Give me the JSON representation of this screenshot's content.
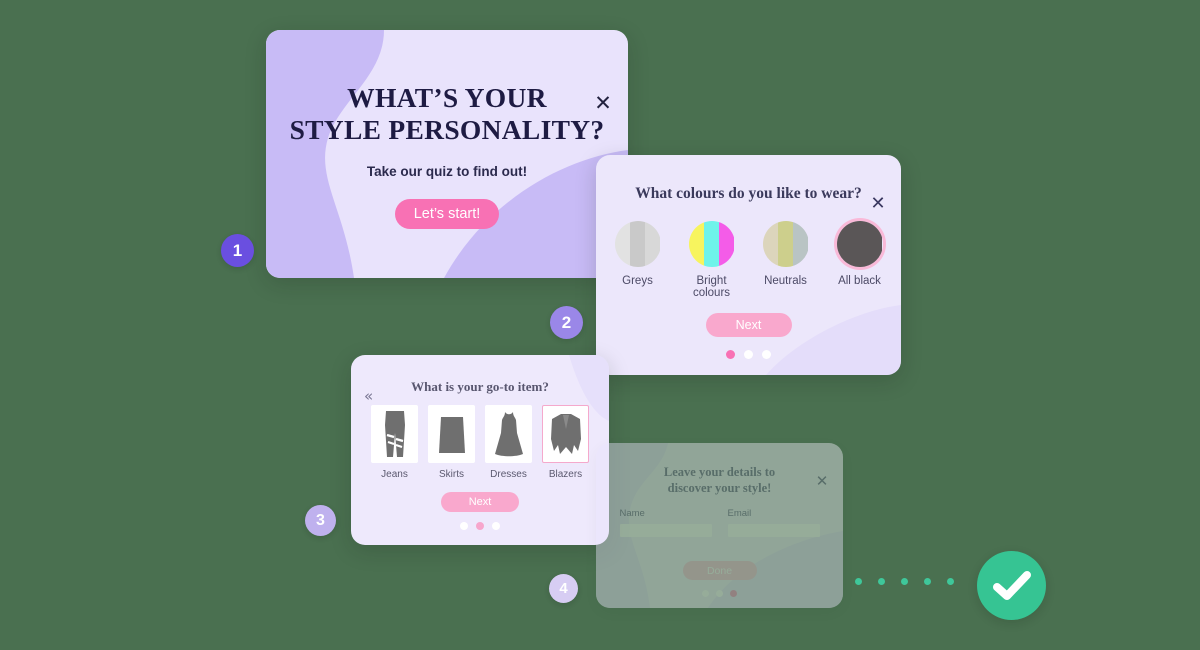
{
  "page": {
    "background_color": "#4a7050"
  },
  "cards": {
    "step1": {
      "title_line1": "WHAT’S YOUR",
      "title_line2": "STYLE PERSONALITY?",
      "subtitle": "Take our quiz to find out!",
      "cta_label": "Let’s start!",
      "close_icon": "close-icon",
      "close_glyph": "✕",
      "bg_color": "#e9e3fc",
      "accent_color": "#f871b4"
    },
    "step2": {
      "title": "What colours do you like to wear?",
      "close_icon": "close-icon",
      "close_glyph": "✕",
      "next_label": "Next",
      "options": [
        {
          "label": "Greys",
          "selected": false,
          "colors": [
            "#e2e2e2",
            "#c9c9c9",
            "#d8d8d8"
          ]
        },
        {
          "label": "Bright colours",
          "selected": false,
          "colors": [
            "#f7f45e",
            "#6ef3ea",
            "#f45ce8"
          ]
        },
        {
          "label": "Neutrals",
          "selected": false,
          "colors": [
            "#dcd5bc",
            "#cdcf8c",
            "#b9c4c4"
          ]
        },
        {
          "label": "All black",
          "selected": true,
          "colors": [
            "#5a5657",
            "#5a5657",
            "#5a5657"
          ]
        }
      ],
      "pagination": {
        "count": 3,
        "active_index": 0
      },
      "bg_color": "#ece7fb"
    },
    "step3": {
      "title": "What is your go-to item?",
      "back_glyph": "«",
      "back_icon": "back-chevron-icon",
      "next_label": "Next",
      "options": [
        {
          "label": "Jeans",
          "icon": "jeans-icon",
          "selected": false
        },
        {
          "label": "Skirts",
          "icon": "skirt-icon",
          "selected": false
        },
        {
          "label": "Dresses",
          "icon": "dress-icon",
          "selected": false
        },
        {
          "label": "Blazers",
          "icon": "blazer-icon",
          "selected": true
        }
      ],
      "pagination": {
        "count": 3,
        "active_index": 1
      },
      "bg_color": "#eee9fc"
    },
    "step4": {
      "title_line1": "Leave your details to",
      "title_line2": "discover your style!",
      "close_icon": "close-icon",
      "close_glyph": "✕",
      "fields": [
        {
          "label": "Name",
          "value": "",
          "placeholder": ""
        },
        {
          "label": "Email",
          "value": "",
          "placeholder": ""
        }
      ],
      "submit_label": "Done",
      "pagination": {
        "count": 3,
        "active_index": 2
      },
      "bg_color": "#f3effc"
    }
  },
  "badges": [
    {
      "label": "1",
      "color": "#6a4fe0"
    },
    {
      "label": "2",
      "color": "#9a87e8"
    },
    {
      "label": "3",
      "color": "#bfb1ee"
    },
    {
      "label": "4",
      "color": "#d7cdf3"
    }
  ],
  "progress": {
    "dot_count": 5,
    "dot_color": "#3fc79a",
    "check_icon": "check-icon",
    "check_color": "#36c493"
  }
}
